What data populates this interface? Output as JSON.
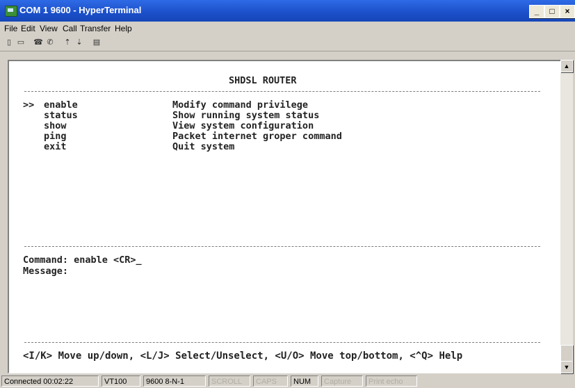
{
  "window": {
    "title": "COM 1 9600 - HyperTerminal"
  },
  "menu": [
    "File",
    "Edit",
    "View",
    "Call",
    "Transfer",
    "Help"
  ],
  "toolbar": {
    "icons": [
      "new-icon",
      "open-icon",
      "connect-icon",
      "disconnect-icon",
      "send-icon",
      "receive-icon",
      "properties-icon"
    ]
  },
  "terminal": {
    "header": "SHDSL ROUTER",
    "menu_items": [
      {
        "marker": ">>",
        "command": "enable",
        "description": "Modify command privilege"
      },
      {
        "marker": "",
        "command": "status",
        "description": "Show running system status"
      },
      {
        "marker": "",
        "command": "show",
        "description": "View system configuration"
      },
      {
        "marker": "",
        "command": "ping",
        "description": "Packet internet groper command"
      },
      {
        "marker": "",
        "command": "exit",
        "description": "Quit system"
      }
    ],
    "command_line": "Command: enable <CR>_",
    "message_line": "Message:",
    "help_line": "<I/K> Move up/down, <L/J> Select/Unselect, <U/O> Move top/bottom, <^Q> Help"
  },
  "statusbar": [
    "Connected 00:02:22",
    "VT100",
    "9600 8-N-1",
    "SCROLL",
    "CAPS",
    "NUM",
    "Capture",
    "Print echo"
  ]
}
